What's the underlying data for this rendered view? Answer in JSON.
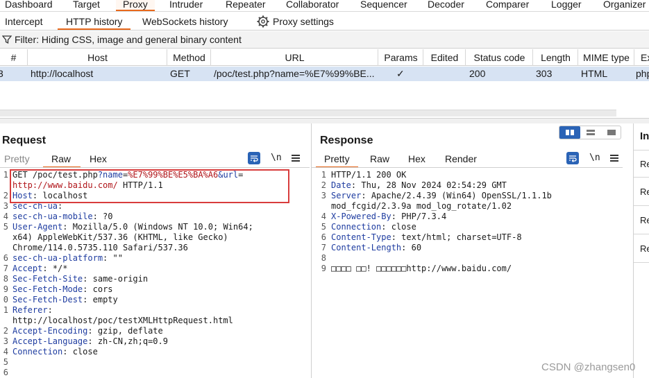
{
  "top_tabs": [
    "Dashboard",
    "Target",
    "Proxy",
    "Intruder",
    "Repeater",
    "Collaborator",
    "Sequencer",
    "Decoder",
    "Comparer",
    "Logger",
    "Organizer"
  ],
  "sub_tabs": [
    "Intercept",
    "HTTP history",
    "WebSockets history"
  ],
  "proxy_settings_label": "Proxy settings",
  "filter_text": "Filter: Hiding CSS, image and general binary content",
  "table": {
    "headers": [
      "#",
      "Host",
      "Method",
      "URL",
      "Params",
      "Edited",
      "Status code",
      "Length",
      "MIME type",
      "Ex"
    ],
    "row": {
      "id": "3",
      "host": "http://localhost",
      "method": "GET",
      "url": "/poc/test.php?name=%E7%99%BE...",
      "params": "✓",
      "edited": "",
      "status": "200",
      "length": "303",
      "mime": "HTML",
      "ext": "php"
    }
  },
  "request": {
    "title": "Request",
    "tabs": [
      "Pretty",
      "Raw",
      "Hex"
    ],
    "active_tab": "Raw",
    "line_numbers": [
      "1",
      "",
      "2",
      "3",
      "4",
      "5",
      "",
      "",
      "6",
      "7",
      "8",
      "9",
      "0",
      "1",
      "",
      "2",
      "3",
      "4",
      "5",
      "6"
    ],
    "line1_a": "GET /poc/test.php",
    "line1_b": "?name",
    "line1_c": "=",
    "line1_d": "%E7%99%BE%E5%BA%A6",
    "line1_e": "&url",
    "line1_f": "=",
    "line1_g": "http://www.baidu.com/",
    "line1_h": " HTTP/1.1",
    "headers": [
      {
        "k": "Host",
        "v": " localhost"
      },
      {
        "k": "sec-ch-ua",
        "v": ""
      },
      {
        "k": "sec-ch-ua-mobile",
        "v": " ?0"
      },
      {
        "k": "User-Agent",
        "v": " Mozilla/5.0 (Windows NT 10.0; Win64;"
      },
      {
        "k": "",
        "v": "x64) AppleWebKit/537.36 (KHTML, like Gecko)"
      },
      {
        "k": "",
        "v": "Chrome/114.0.5735.110 Safari/537.36"
      },
      {
        "k": "sec-ch-ua-platform",
        "v": " \"\""
      },
      {
        "k": "Accept",
        "v": " */*"
      },
      {
        "k": "Sec-Fetch-Site",
        "v": " same-origin"
      },
      {
        "k": "Sec-Fetch-Mode",
        "v": " cors"
      },
      {
        "k": "Sec-Fetch-Dest",
        "v": " empty"
      },
      {
        "k": "Referer",
        "v": ""
      },
      {
        "k": "",
        "v": "http://localhost/poc/testXMLHttpRequest.html"
      },
      {
        "k": "Accept-Encoding",
        "v": " gzip, deflate"
      },
      {
        "k": "Accept-Language",
        "v": " zh-CN,zh;q=0.9"
      },
      {
        "k": "Connection",
        "v": " close"
      },
      {
        "k": "",
        "v": ""
      },
      {
        "k": "",
        "v": ""
      }
    ]
  },
  "response": {
    "title": "Response",
    "tabs": [
      "Pretty",
      "Raw",
      "Hex",
      "Render"
    ],
    "active_tab": "Pretty",
    "line_numbers": [
      "1",
      "2",
      "3",
      "",
      "4",
      "5",
      "6",
      "7",
      "8",
      "9"
    ],
    "lines": [
      {
        "k": "",
        "v": "HTTP/1.1 200 OK"
      },
      {
        "k": "Date",
        "v": " Thu, 28 Nov 2024 02:54:29 GMT"
      },
      {
        "k": "Server",
        "v": " Apache/2.4.39 (Win64) OpenSSL/1.1.1b"
      },
      {
        "k": "",
        "v": "mod_fcgid/2.3.9a mod_log_rotate/1.02"
      },
      {
        "k": "X-Powered-By",
        "v": " PHP/7.3.4"
      },
      {
        "k": "Connection",
        "v": " close"
      },
      {
        "k": "Content-Type",
        "v": " text/html; charset=UTF-8"
      },
      {
        "k": "Content-Length",
        "v": " 60"
      },
      {
        "k": "",
        "v": ""
      },
      {
        "k": "",
        "v": "□□□□ □□! □□□□□□http://www.baidu.com/"
      }
    ]
  },
  "side": {
    "title": "In",
    "cards": [
      "Re",
      "Re",
      "Re",
      "Re"
    ]
  },
  "watermark": "CSDN @zhangsen0"
}
